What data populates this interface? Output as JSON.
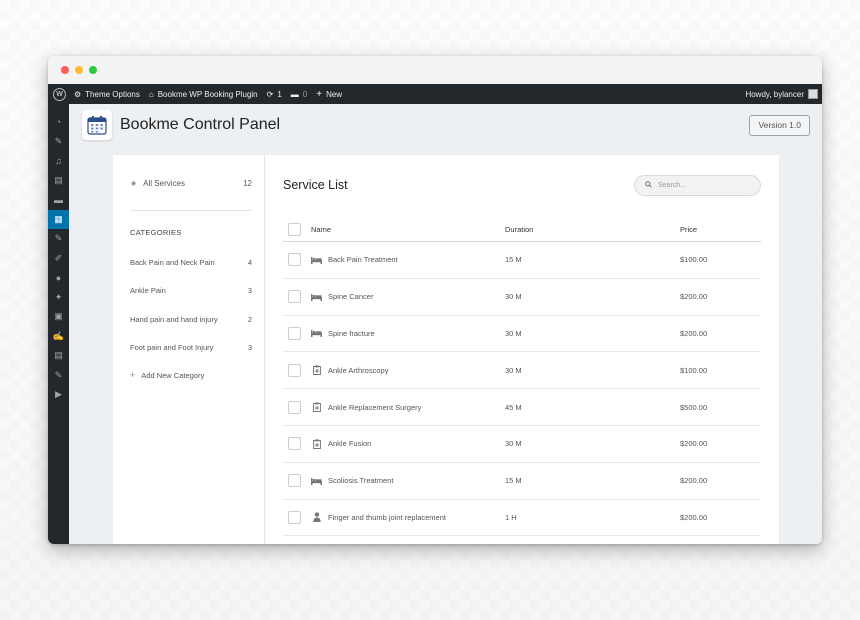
{
  "colors": {
    "admin_bar": "#23282d",
    "active_menu": "#0073aa",
    "content_bg": "#edf0f3",
    "dot_red": "#fc5f57",
    "dot_yellow": "#fdbc2e",
    "dot_green": "#2bc840"
  },
  "admin_bar": {
    "theme_options": "Theme Options",
    "site_name": "Bookme WP Booking Plugin",
    "updates_count": "1",
    "comments_count": "0",
    "new_label": "New",
    "howdy": "Howdy, bylancer"
  },
  "sidebar_icons": [
    "dashboard-icon",
    "pin-icon",
    "media-icon",
    "pages-icon",
    "comments-icon",
    "calendar-icon",
    "pin-icon",
    "brush-icon",
    "users-icon",
    "tools-icon",
    "settings-icon",
    "edit-icon",
    "list-icon",
    "pin-icon",
    "play-icon"
  ],
  "header": {
    "title": "Bookme Control Panel",
    "version": "Version 1.0"
  },
  "left": {
    "all_services": "All Services",
    "all_count": "12",
    "categories_heading": "CATEGORIES",
    "categories": [
      {
        "name": "Back Pain and Neck Pain",
        "count": "4"
      },
      {
        "name": "Ankle Pain",
        "count": "3"
      },
      {
        "name": "Hand pain and hand injury",
        "count": "2"
      },
      {
        "name": "Foot pain and Foot Injury",
        "count": "3"
      }
    ],
    "add_category": "Add New Category"
  },
  "list": {
    "title": "Service List",
    "search_placeholder": "Search...",
    "columns": {
      "name": "Name",
      "duration": "Duration",
      "price": "Price"
    },
    "rows": [
      {
        "icon": "bed-icon",
        "name": "Back Pain Treatment",
        "duration": "15 M",
        "price": "$100.00"
      },
      {
        "icon": "bed-icon",
        "name": "Spine Cancer",
        "duration": "30 M",
        "price": "$200.00"
      },
      {
        "icon": "bed-icon",
        "name": "Spine fracture",
        "duration": "30 M",
        "price": "$200.00"
      },
      {
        "icon": "clipboard-icon",
        "name": "Ankle Arthroscopy",
        "duration": "30 M",
        "price": "$100.00"
      },
      {
        "icon": "clipboard-icon",
        "name": "Ankle Replacement Surgery",
        "duration": "45 M",
        "price": "$500.00"
      },
      {
        "icon": "clipboard-icon",
        "name": "Ankle Fusion",
        "duration": "30 M",
        "price": "$200.00"
      },
      {
        "icon": "bed-icon",
        "name": "Scoliosis Treatment",
        "duration": "15 M",
        "price": "$200.00"
      },
      {
        "icon": "user-md-icon",
        "name": "Finger and thumb joint replacement",
        "duration": "1 H",
        "price": "$200.00"
      }
    ]
  }
}
